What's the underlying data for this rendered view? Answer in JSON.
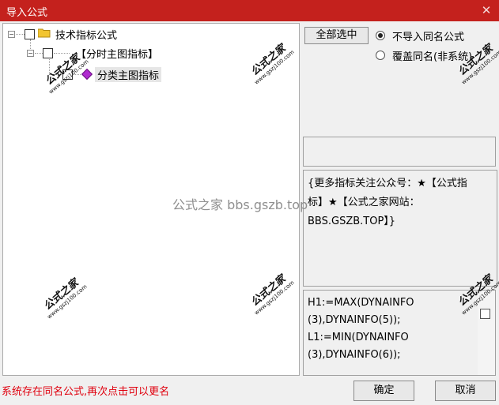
{
  "window": {
    "title": "导入公式",
    "close_glyph": "✕"
  },
  "tree": {
    "root_label": "技术指标公式",
    "group_label": "【分时主图指标】",
    "item_label": "分类主图指标",
    "expander_minus": "−"
  },
  "options": {
    "select_all_label": "全部选中",
    "radio_skip_label": "不导入同名公式",
    "radio_overwrite_label": "覆盖同名(非系统)",
    "selected_radio": "skip"
  },
  "notice_text": "{更多指标关注公众号：★【公式指标】★【公式之家网站：BBS.GSZB.TOP】}",
  "code_text": "H1:=MAX(DYNAINFO(3),DYNAINFO(5));\nL1:=MIN(DYNAINFO(3),DYNAINFO(6));",
  "code_lines": [
    "H1:=MAX(DYNAINFO",
    "(3),DYNAINFO(5));",
    "L1:=MIN(DYNAINFO",
    "(3),DYNAINFO(6));"
  ],
  "status_message": "系统存在同名公式,再次点击可以更名",
  "buttons": {
    "ok": "确定",
    "cancel": "取消"
  },
  "watermark": {
    "center": "公式之家 bbs.gszb.top",
    "stamp_main": "公式之家",
    "stamp_url": "www.gszj100.com"
  },
  "colors": {
    "titlebar": "#c4211d",
    "status_text": "#e0000e",
    "folder": "#f2c531",
    "gem": "#b02ad0"
  }
}
